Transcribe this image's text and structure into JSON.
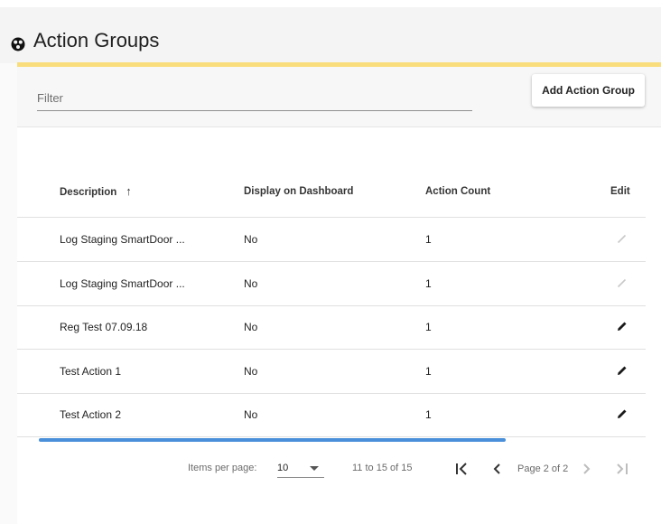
{
  "header": {
    "title": "Action Groups",
    "icon": "settings-circle-icon"
  },
  "toolbar": {
    "filter_placeholder": "Filter",
    "add_label": "Add Action Group"
  },
  "table": {
    "columns": [
      "Description",
      "Display on Dashboard",
      "Action Count",
      "Edit"
    ],
    "sort_column": "Description",
    "sort_direction": "ascending",
    "rows": [
      {
        "description": "Log Staging SmartDoor ...",
        "dashboard": "No",
        "count": "1",
        "edit_enabled": false
      },
      {
        "description": "Log Staging SmartDoor ...",
        "dashboard": "No",
        "count": "1",
        "edit_enabled": false
      },
      {
        "description": "Reg Test 07.09.18",
        "dashboard": "No",
        "count": "1",
        "edit_enabled": true
      },
      {
        "description": "Test Action 1",
        "dashboard": "No",
        "count": "1",
        "edit_enabled": true
      },
      {
        "description": "Test Action 2",
        "dashboard": "No",
        "count": "1",
        "edit_enabled": true
      }
    ]
  },
  "paginator": {
    "items_per_page_label": "Items per page:",
    "items_per_page": "10",
    "range": "11 to 15 of 15",
    "page": "Page 2 of 2"
  },
  "colors": {
    "accent": "#f9dd7c",
    "scrollbar": "#4a8fd9",
    "edit_enabled": "#1a1a1a",
    "edit_disabled": "#c9c9c9"
  }
}
